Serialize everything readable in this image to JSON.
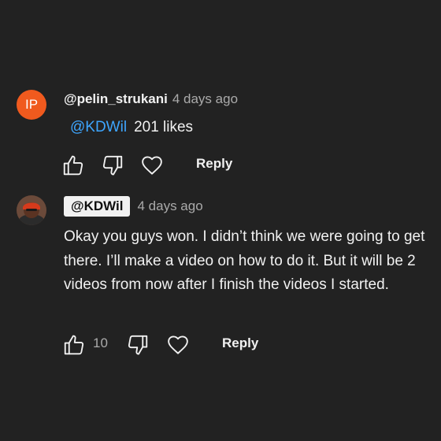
{
  "comments": [
    {
      "avatar_initials": "IP",
      "avatar_color": "#f05a1e",
      "username": "@pelin_strukani",
      "time": "4 days ago",
      "mention": "@KDWil",
      "text": "201 likes",
      "like_count": "",
      "reply_label": "Reply"
    },
    {
      "avatar_icon": "user-avatar-photo",
      "username": "@KDWil",
      "time": "4 days ago",
      "text": "Okay you guys won. I didn’t think we were going to get there. I’ll make a video on how to do it. But it will be 2 videos from now after I finish the videos I started.",
      "like_count": "10",
      "reply_label": "Reply"
    }
  ],
  "colors": {
    "background": "#222222",
    "text": "#f1f1f1",
    "muted": "#aaaaaa",
    "link": "#3ea6ff"
  }
}
